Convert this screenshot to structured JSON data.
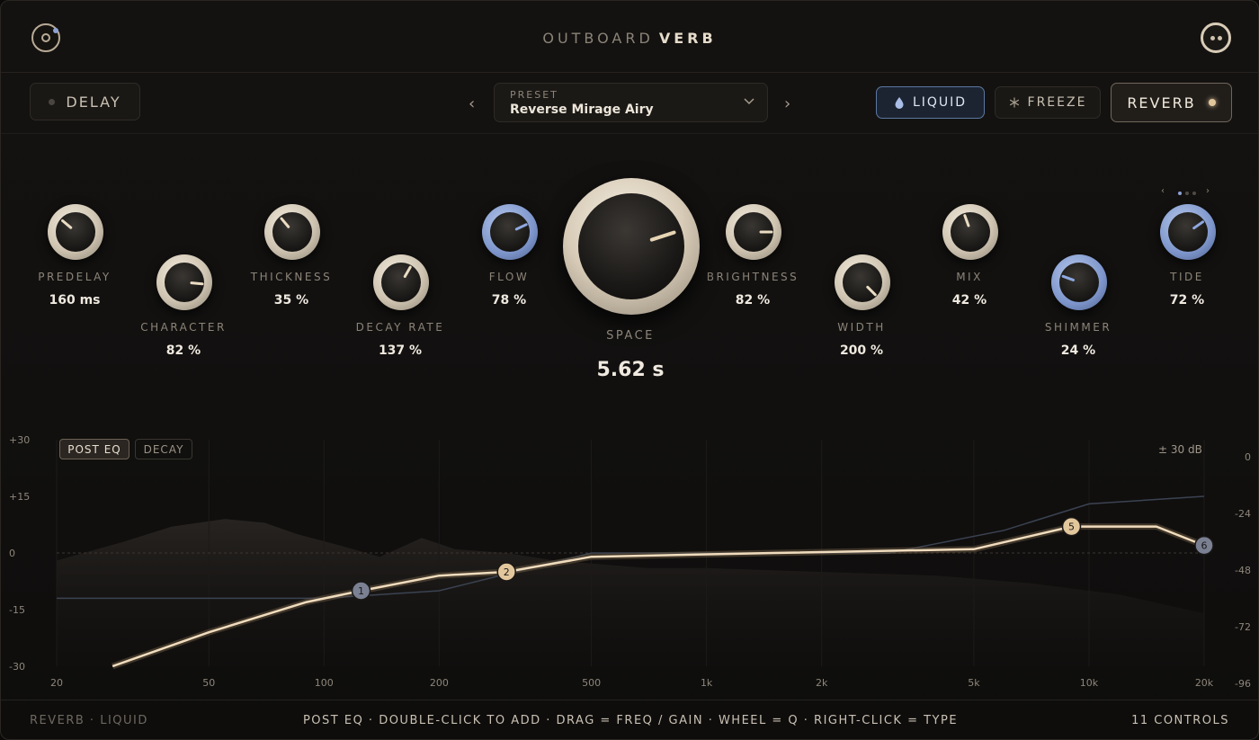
{
  "header": {
    "title_light": "OUTBOARD",
    "title_bold": "VERB"
  },
  "toolbar": {
    "delay_label": "DELAY",
    "preset_caption": "PRESET",
    "preset_value": "Reverse Mirage Airy",
    "prev_glyph": "‹",
    "next_glyph": "›",
    "liquid_label": "LIQUID",
    "freeze_label": "FREEZE",
    "reverb_label": "REVERB",
    "pager_left": "‹",
    "pager_right": "›"
  },
  "knobs": [
    {
      "id": "predelay",
      "label": "PREDELAY",
      "value": "160 ms",
      "color": "cream",
      "angle": -50
    },
    {
      "id": "character",
      "label": "CHARACTER",
      "value": "82 %",
      "color": "cream",
      "angle": 95
    },
    {
      "id": "thickness",
      "label": "THICKNESS",
      "value": "35 %",
      "color": "cream",
      "angle": -40
    },
    {
      "id": "decay-rate",
      "label": "DECAY RATE",
      "value": "137 %",
      "color": "cream",
      "angle": 30
    },
    {
      "id": "flow",
      "label": "FLOW",
      "value": "78 %",
      "color": "blue",
      "angle": 65
    },
    {
      "id": "brightness",
      "label": "BRIGHTNESS",
      "value": "82 %",
      "color": "cream",
      "angle": 90
    },
    {
      "id": "width",
      "label": "WIDTH",
      "value": "200 %",
      "color": "cream",
      "angle": 135
    },
    {
      "id": "mix",
      "label": "MIX",
      "value": "42 %",
      "color": "cream",
      "angle": -20
    },
    {
      "id": "shimmer",
      "label": "SHIMMER",
      "value": "24 %",
      "color": "blue",
      "angle": -70
    },
    {
      "id": "tide",
      "label": "TIDE",
      "value": "72 %",
      "color": "blue",
      "angle": 55
    }
  ],
  "space": {
    "label": "SPACE",
    "value": "5.62 s",
    "angle": 72
  },
  "eq": {
    "tabs": [
      "POST EQ",
      "DECAY"
    ],
    "active_tab": "POST EQ",
    "range_label": "± 30 dB",
    "left_axis": [
      "+30",
      "+15",
      "0",
      "-15",
      "-30"
    ],
    "right_axis": [
      "0",
      "-24",
      "-48",
      "-72",
      "-96"
    ],
    "freq_ticks": [
      "20",
      "50",
      "100",
      "200",
      "500",
      "1k",
      "2k",
      "5k",
      "10k",
      "20k"
    ],
    "nodes": [
      "1",
      "2",
      "5",
      "6"
    ]
  },
  "footer": {
    "left": "REVERB · LIQUID",
    "center": "POST EQ · DOUBLE-CLICK TO ADD · DRAG = FREQ / GAIN · WHEEL = Q · RIGHT-CLICK = TYPE",
    "right": "11 CONTROLS"
  },
  "colors": {
    "accent": "#e3c79c",
    "blue": "#7d95cb",
    "background": "#121110"
  }
}
